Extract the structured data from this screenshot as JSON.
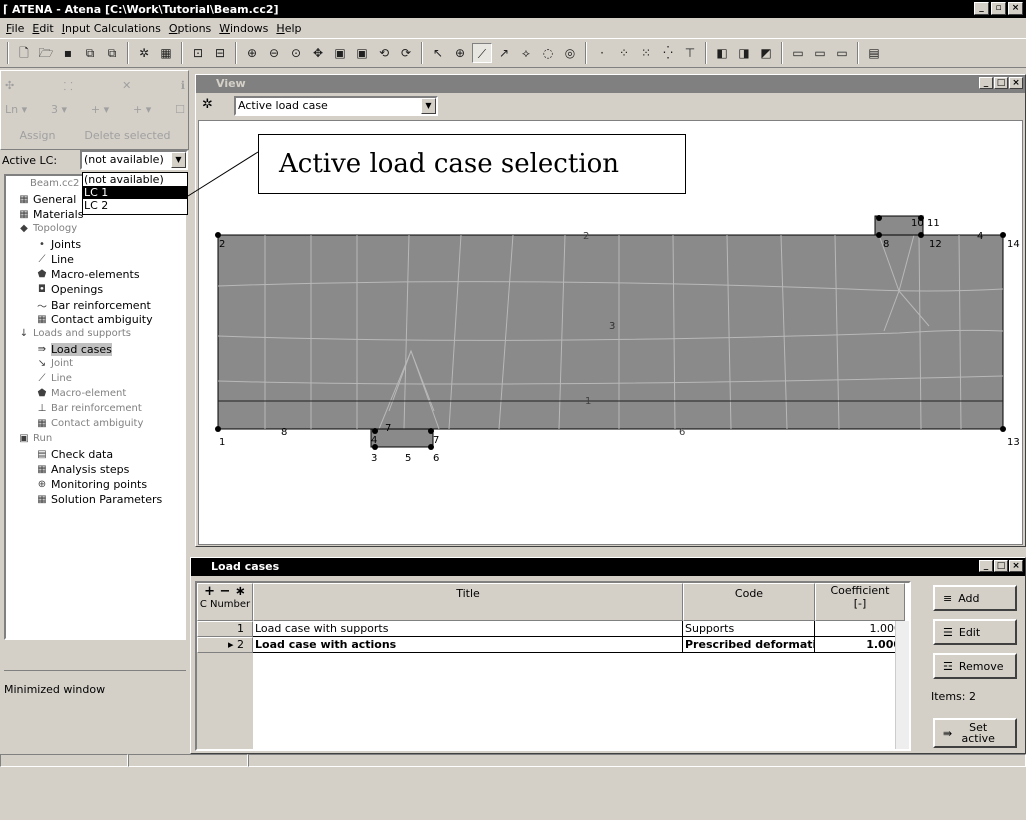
{
  "app": {
    "title": "ATENA - Atena [C:\\Work\\Tutorial\\Beam.cc2]"
  },
  "menu": [
    "File",
    "Edit",
    "Input Calculations",
    "Options",
    "Windows",
    "Help"
  ],
  "left_panel": {
    "row2": [
      "Ln",
      "3",
      "+",
      "+"
    ],
    "assign_label": "Assign",
    "delete_label": "Delete selected",
    "active_lc_label": "Active LC:",
    "active_lc_value": "(not available)",
    "dropdown_options": [
      "(not available)",
      "LC 1",
      "LC 2"
    ],
    "tree": {
      "root": "Beam.cc2",
      "general": "General",
      "materials": "Materials",
      "topology": "Topology",
      "joints": "Joints",
      "line": "Line",
      "macro": "Macro-elements",
      "openings": "Openings",
      "bar": "Bar reinforcement",
      "contact": "Contact ambiguity",
      "loads": "Loads and supports",
      "loadcases": "Load cases",
      "l_joint": "Joint",
      "l_line": "Line",
      "l_macro": "Macro-element",
      "l_bar": "Bar reinforcement",
      "l_contact": "Contact ambiguity",
      "run": "Run",
      "check": "Check data",
      "steps": "Analysis steps",
      "monitoring": "Monitoring points",
      "solution": "Solution Parameters"
    },
    "minimized_text": "Minimized window"
  },
  "view": {
    "title": "View",
    "combo_value": "Active load case",
    "callout": "Active load case selection",
    "labels": {
      "n1": "1",
      "n2": "2",
      "n3": "3",
      "n4": "4",
      "n5": "5",
      "n6": "6",
      "n7": "7",
      "n8": "8",
      "n10": "10",
      "n11": "11",
      "n12": "12",
      "n13": "13",
      "n14": "14",
      "l2": "2",
      "l1": "1",
      "l6": "6",
      "l4": "4",
      "l7": "7",
      "l8": "8",
      "l3": "3"
    }
  },
  "load_cases": {
    "title": "Load cases",
    "columns": [
      "C Number",
      "Title",
      "Code",
      "Coefficient",
      "[-]"
    ],
    "rows": [
      {
        "num": "1",
        "title": "Load case with supports",
        "code": "Supports",
        "coef": "1.000"
      },
      {
        "num": "2",
        "title": "Load case with actions",
        "code": "Prescribed deformati",
        "coef": "1.000"
      }
    ],
    "add": "Add",
    "edit": "Edit",
    "remove": "Remove",
    "items": "Items: 2",
    "set_active": "Set active"
  }
}
